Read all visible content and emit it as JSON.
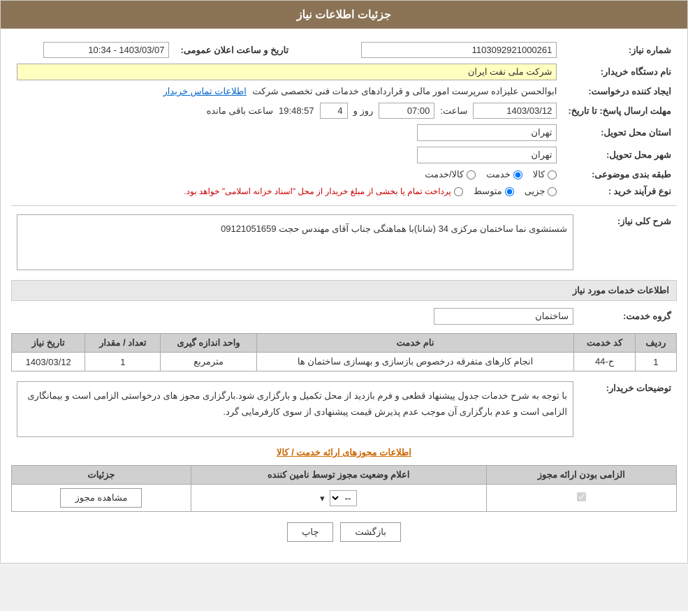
{
  "header": {
    "title": "جزئیات اطلاعات نیاز"
  },
  "fields": {
    "need_number_label": "شماره نیاز:",
    "need_number_value": "1103092921000261",
    "buyer_org_label": "نام دستگاه خریدار:",
    "buyer_org_value": "شرکت ملی نفت ایران",
    "requester_label": "ایجاد کننده درخواست:",
    "requester_value": "ابوالحسن علیزاده سرپرست امور مالی و قراردادهای خدمات فنی تخصصی شرکت",
    "requester_link": "اطلاعات تماس خریدار",
    "response_deadline_label": "مهلت ارسال پاسخ: تا تاریخ:",
    "date_value": "1403/03/12",
    "time_label": "ساعت:",
    "time_value": "07:00",
    "days_label": "روز و",
    "days_value": "4",
    "remaining_label": "ساعت باقی مانده",
    "remaining_value": "19:48:57",
    "announce_datetime_label": "تاریخ و ساعت اعلان عمومی:",
    "announce_datetime_value": "1403/03/07 - 10:34",
    "province_label": "استان محل تحویل:",
    "province_value": "تهران",
    "city_label": "شهر محل تحویل:",
    "city_value": "تهران",
    "subject_label": "طبقه بندی موضوعی:",
    "radio_options": [
      "کالا",
      "خدمت",
      "کالا/خدمت"
    ],
    "radio_selected": "خدمت",
    "purchase_type_label": "نوع فرآیند خرید :",
    "purchase_types": [
      "جزیی",
      "متوسط",
      "پرداخت تمام یا بخشی از مبلغ خریدار از محل \"اسناد خزانه اسلامی\" خواهد بود."
    ],
    "purchase_selected": "متوسط"
  },
  "general_description": {
    "label": "شرح کلی نیاز:",
    "value": "شستشوی نما ساختمان مرکزی 34 (شانا)با هماهنگی جناب آقای مهندس حجت 09121051659"
  },
  "services_section": {
    "title": "اطلاعات خدمات مورد نیاز",
    "service_group_label": "گروه خدمت:",
    "service_group_value": "ساختمان",
    "table": {
      "columns": [
        "ردیف",
        "کد خدمت",
        "نام خدمت",
        "واحد اندازه گیری",
        "تعداد / مقدار",
        "تاریخ نیاز"
      ],
      "rows": [
        {
          "row": "1",
          "code": "ح-44",
          "name": "انجام کارهای متفرقه درخصوص بازسازی و بهسازی ساختمان ها",
          "unit": "مترمربع",
          "quantity": "1",
          "date": "1403/03/12"
        }
      ]
    }
  },
  "buyer_notes": {
    "label": "توضیحات خریدار:",
    "value": "با توجه به شرح خدمات جدول پیشنهاد قطعی و فرم بازدید از محل تکمیل و بارگزاری شود.بارگزاری مجوز های درخواستی الزامی است و بیمانگاری الزامی است و عدم بارگزاری آن موجب عدم پذیرش قیمت پیشنهادی از سوی کارفرمایی گرد."
  },
  "license_section": {
    "link_text": "اطلاعات مجوزهای ارائه خدمت / کالا",
    "table": {
      "columns": [
        "الزامی بودن ارائه مجوز",
        "اعلام وضعیت مجوز توسط نامین کننده",
        "جزئیات"
      ],
      "rows": [
        {
          "required": true,
          "status_placeholder": "--",
          "details_btn": "مشاهده مجوز"
        }
      ]
    }
  },
  "footer": {
    "back_btn": "بازگشت",
    "print_btn": "چاپ"
  }
}
